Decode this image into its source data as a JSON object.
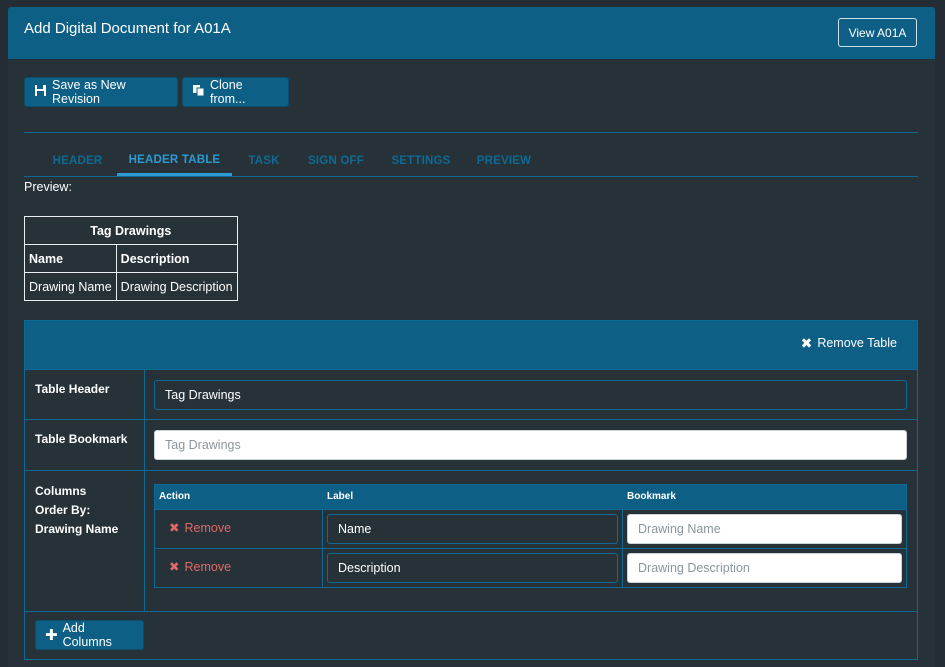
{
  "header": {
    "title": "Add Digital Document for A01A",
    "view_button": "View A01A"
  },
  "toolbar": {
    "save_label": "Save as New Revision",
    "clone_label": "Clone from..."
  },
  "tabs": [
    {
      "label": "HEADER",
      "active": false
    },
    {
      "label": "HEADER TABLE",
      "active": true
    },
    {
      "label": "TASK",
      "active": false
    },
    {
      "label": "SIGN OFF",
      "active": false
    },
    {
      "label": "SETTINGS",
      "active": false
    },
    {
      "label": "PREVIEW",
      "active": false
    }
  ],
  "preview": {
    "label": "Preview:",
    "caption": "Tag Drawings",
    "headers": [
      "Name",
      "Description"
    ],
    "cells": [
      "Drawing Name",
      "Drawing Description"
    ]
  },
  "table_section": {
    "remove_table_label": "Remove Table",
    "table_header_label": "Table Header",
    "table_header_value": "Tag Drawings",
    "table_bookmark_label": "Table Bookmark",
    "table_bookmark_placeholder": "Tag Drawings",
    "columns_label": "Columns",
    "order_by_label": "Order By:",
    "order_by_value": "Drawing Name",
    "columns_headers": {
      "action": "Action",
      "label": "Label",
      "bookmark": "Bookmark"
    },
    "columns": [
      {
        "remove_label": "Remove",
        "label": "Name",
        "bookmark_placeholder": "Drawing Name"
      },
      {
        "remove_label": "Remove",
        "label": "Description",
        "bookmark_placeholder": "Drawing Description"
      }
    ],
    "add_columns_label": "Add Columns"
  },
  "colors": {
    "accent": "#0e5f86",
    "border": "#0e6a94",
    "background": "#263238",
    "tab_active": "#2b9bd2",
    "remove_red": "#e0686a"
  }
}
